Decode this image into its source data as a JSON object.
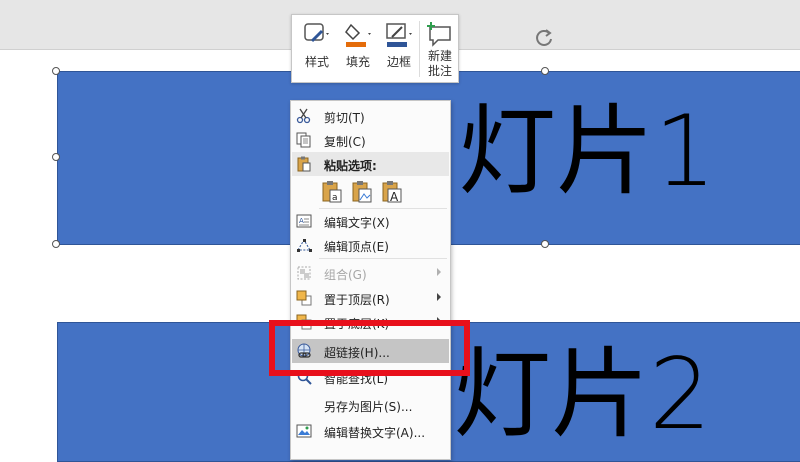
{
  "mini_toolbar": {
    "style_label": "样式",
    "fill_label": "填充",
    "border_label": "边框",
    "new_comment_line1": "新建",
    "new_comment_line2": "批注"
  },
  "slides": [
    {
      "text": "灯片1"
    },
    {
      "text": "灯片2"
    }
  ],
  "context_menu": {
    "items": [
      {
        "label": "剪切(T)",
        "icon": "scissors-icon"
      },
      {
        "label": "复制(C)",
        "icon": "copy-icon"
      },
      {
        "label": "粘贴选项:",
        "icon": "paste-icon"
      },
      {
        "label": "编辑文字(X)",
        "icon": "edit-text-icon"
      },
      {
        "label": "编辑顶点(E)",
        "icon": "edit-points-icon"
      },
      {
        "label": "组合(G)",
        "icon": "group-icon",
        "disabled": true
      },
      {
        "label": "置于顶层(R)",
        "icon": "bring-to-front-icon"
      },
      {
        "label": "置于底层(K)",
        "icon": "send-to-back-icon"
      },
      {
        "label": "超链接(H)...",
        "icon": "hyperlink-icon"
      },
      {
        "label": "智能查找(L)",
        "icon": "smart-lookup-icon"
      },
      {
        "label": "另存为图片(S)..."
      },
      {
        "label": "编辑替换文字(A)...",
        "icon": "alt-text-icon"
      }
    ],
    "paste_options": [
      "keep-source-format-icon",
      "picture-icon",
      "keep-text-only-icon"
    ]
  },
  "colors": {
    "shape_fill": "#4472c4",
    "highlight_box": "#e8101c",
    "fill_swatch": "#e46c0a",
    "border_swatch": "#2f5597"
  }
}
